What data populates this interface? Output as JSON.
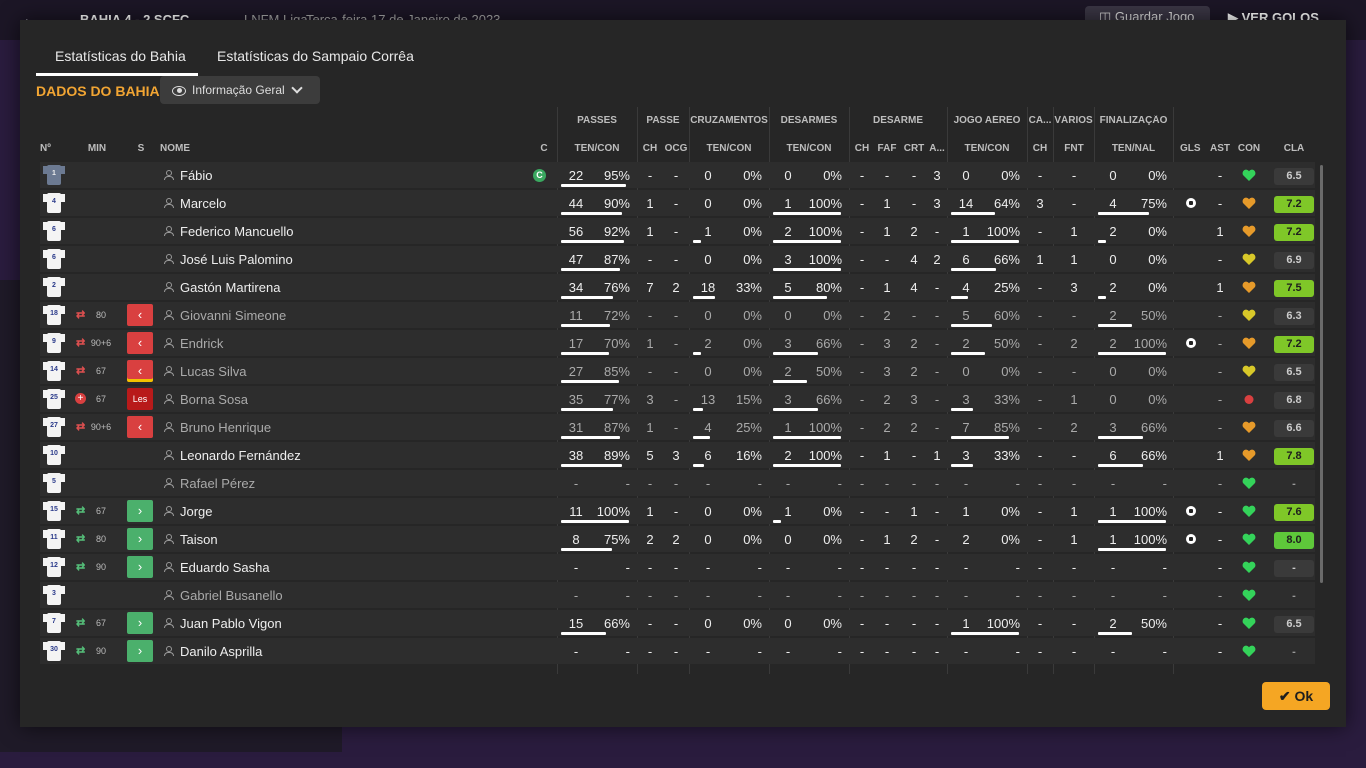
{
  "background": {
    "back_icon": "arrow-left-icon",
    "scoreline": "BAHIA 4 - 2 SCFC",
    "competition": "LNFM Liga",
    "date": "Terça-feira 17 de Janeiro de 2023",
    "save_button": "Guardar Jogo",
    "goals_button": "VER GOLOS"
  },
  "tabs": [
    {
      "label": "Estatísticas do Bahia",
      "active": true
    },
    {
      "label": "Estatísticas do Sampaio Corrêa",
      "active": false
    }
  ],
  "section_title": "DADOS DO BAHIA",
  "view_dropdown": {
    "label": "Informação Geral",
    "icon": "eye-icon"
  },
  "group_headers": [
    "PASSES",
    "PASSE",
    "CRUZAMENTOS",
    "DESARMES",
    "DESARME",
    "JOGO AÉREO",
    "CA...",
    "VÁRIOS",
    "FINALIZAÇÃO"
  ],
  "column_headers": {
    "num": "Nº",
    "min": "MIN",
    "s": "S",
    "name": "NOME",
    "c": "C",
    "passes": "TEN/CON",
    "passe_ch": "CH",
    "passe_ocg": "OCG",
    "cruz": "TEN/CON",
    "desarmes": "TEN/CON",
    "des_ch": "CH",
    "des_faf": "FAF",
    "des_crt": "CRT",
    "des_a": "A...",
    "aereo": "TEN/CON",
    "ca_ch": "CH",
    "varios_fnt": "FNT",
    "final": "TEN/NAL",
    "gls": "GLS",
    "ast": "AST",
    "con": "CON",
    "cla": "CLA"
  },
  "colors": {
    "accent": "#f2a533",
    "ok_button": "#f5a623",
    "sub_out": "#d94040",
    "sub_in": "#4bb06c",
    "heart_green": "#34d35a",
    "heart_orange": "#e69a2a",
    "heart_yellow": "#d8c829",
    "rating_green": "#7fc728"
  },
  "players": [
    {
      "num": "1",
      "gk": true,
      "min": "",
      "sub": "",
      "name": "Fábio",
      "captain": "C",
      "pass": [
        "22",
        "95%"
      ],
      "pass_frac": 0.95,
      "pch": "-",
      "pocg": "-",
      "cross": [
        "0",
        "0%"
      ],
      "cross_frac": 0,
      "tack": [
        "0",
        "0%"
      ],
      "tack_frac": 0,
      "dch": "-",
      "faf": "-",
      "crt": "-",
      "da": "3",
      "air": [
        "0",
        "0%"
      ],
      "air_frac": 0,
      "cach": "-",
      "fnt": "-",
      "fin": [
        "0",
        "0%"
      ],
      "fin_frac": 0,
      "gls": "",
      "ast": "-",
      "con": "green",
      "cla": "6.5",
      "cla_style": "grey",
      "dim": false
    },
    {
      "num": "4",
      "gk": false,
      "min": "",
      "sub": "",
      "name": "Marcelo",
      "captain": "",
      "pass": [
        "44",
        "90%"
      ],
      "pass_frac": 0.9,
      "pch": "1",
      "pocg": "-",
      "cross": [
        "0",
        "0%"
      ],
      "cross_frac": 0,
      "tack": [
        "1",
        "100%"
      ],
      "tack_frac": 1,
      "dch": "-",
      "faf": "1",
      "crt": "-",
      "da": "3",
      "air": [
        "14",
        "64%"
      ],
      "air_frac": 0.64,
      "cach": "3",
      "fnt": "-",
      "fin": [
        "4",
        "75%"
      ],
      "fin_frac": 0.75,
      "gls": "ball",
      "ast": "-",
      "con": "orange",
      "cla": "7.2",
      "cla_style": "green",
      "dim": false
    },
    {
      "num": "6",
      "gk": false,
      "min": "",
      "sub": "",
      "name": "Federico Mancuello",
      "captain": "",
      "pass": [
        "56",
        "92%"
      ],
      "pass_frac": 0.92,
      "pch": "1",
      "pocg": "-",
      "cross": [
        "1",
        "0%"
      ],
      "cross_frac": 0,
      "tack": [
        "2",
        "100%"
      ],
      "tack_frac": 1,
      "dch": "-",
      "faf": "1",
      "crt": "2",
      "da": "-",
      "air": [
        "1",
        "100%"
      ],
      "air_frac": 1,
      "cach": "-",
      "fnt": "1",
      "fin": [
        "2",
        "0%"
      ],
      "fin_frac": 0,
      "gls": "",
      "ast": "1",
      "con": "orange",
      "cla": "7.2",
      "cla_style": "green",
      "dim": false
    },
    {
      "num": "6",
      "gk": false,
      "min": "",
      "sub": "",
      "name": "José Luis Palomino",
      "captain": "",
      "pass": [
        "47",
        "87%"
      ],
      "pass_frac": 0.87,
      "pch": "-",
      "pocg": "-",
      "cross": [
        "0",
        "0%"
      ],
      "cross_frac": 0,
      "tack": [
        "3",
        "100%"
      ],
      "tack_frac": 1,
      "dch": "-",
      "faf": "-",
      "crt": "4",
      "da": "2",
      "air": [
        "6",
        "66%"
      ],
      "air_frac": 0.66,
      "cach": "1",
      "fnt": "1",
      "fin": [
        "0",
        "0%"
      ],
      "fin_frac": 0,
      "gls": "",
      "ast": "-",
      "con": "yellow",
      "cla": "6.9",
      "cla_style": "grey",
      "dim": false
    },
    {
      "num": "2",
      "gk": false,
      "min": "",
      "sub": "",
      "name": "Gastón Martirena",
      "captain": "",
      "pass": [
        "34",
        "76%"
      ],
      "pass_frac": 0.76,
      "pch": "7",
      "pocg": "2",
      "cross": [
        "18",
        "33%"
      ],
      "cross_frac": 0.33,
      "tack": [
        "5",
        "80%"
      ],
      "tack_frac": 0.8,
      "dch": "-",
      "faf": "1",
      "crt": "4",
      "da": "-",
      "air": [
        "4",
        "25%"
      ],
      "air_frac": 0.25,
      "cach": "-",
      "fnt": "3",
      "fin": [
        "2",
        "0%"
      ],
      "fin_frac": 0,
      "gls": "",
      "ast": "1",
      "con": "orange",
      "cla": "7.5",
      "cla_style": "green",
      "dim": false
    },
    {
      "num": "18",
      "gk": false,
      "min": "80",
      "sub": "out",
      "name": "Giovanni Simeone",
      "captain": "",
      "pass": [
        "11",
        "72%"
      ],
      "pass_frac": 0.72,
      "pch": "-",
      "pocg": "-",
      "cross": [
        "0",
        "0%"
      ],
      "cross_frac": 0,
      "tack": [
        "0",
        "0%"
      ],
      "tack_frac": 0,
      "dch": "-",
      "faf": "2",
      "crt": "-",
      "da": "-",
      "air": [
        "5",
        "60%"
      ],
      "air_frac": 0.6,
      "cach": "-",
      "fnt": "-",
      "fin": [
        "2",
        "50%"
      ],
      "fin_frac": 0.5,
      "gls": "",
      "ast": "-",
      "con": "yellow",
      "cla": "6.3",
      "cla_style": "grey",
      "dim": true
    },
    {
      "num": "9",
      "gk": false,
      "min": "90+6",
      "sub": "out",
      "name": "Endrick",
      "captain": "",
      "pass": [
        "17",
        "70%"
      ],
      "pass_frac": 0.7,
      "pch": "1",
      "pocg": "-",
      "cross": [
        "2",
        "0%"
      ],
      "cross_frac": 0,
      "tack": [
        "3",
        "66%"
      ],
      "tack_frac": 0.66,
      "dch": "-",
      "faf": "3",
      "crt": "2",
      "da": "-",
      "air": [
        "2",
        "50%"
      ],
      "air_frac": 0.5,
      "cach": "-",
      "fnt": "2",
      "fin": [
        "2",
        "100%"
      ],
      "fin_frac": 1,
      "gls": "ball",
      "ast": "-",
      "con": "orange",
      "cla": "7.2",
      "cla_style": "green",
      "dim": true
    },
    {
      "num": "14",
      "gk": false,
      "min": "67",
      "sub": "out-yc",
      "name": "Lucas Silva",
      "captain": "",
      "pass": [
        "27",
        "85%"
      ],
      "pass_frac": 0.85,
      "pch": "-",
      "pocg": "-",
      "cross": [
        "0",
        "0%"
      ],
      "cross_frac": 0,
      "tack": [
        "2",
        "50%"
      ],
      "tack_frac": 0.5,
      "dch": "-",
      "faf": "3",
      "crt": "2",
      "da": "-",
      "air": [
        "0",
        "0%"
      ],
      "air_frac": 0,
      "cach": "-",
      "fnt": "-",
      "fin": [
        "0",
        "0%"
      ],
      "fin_frac": 0,
      "gls": "",
      "ast": "-",
      "con": "yellow",
      "cla": "6.5",
      "cla_style": "grey",
      "dim": true
    },
    {
      "num": "25",
      "gk": false,
      "min": "67",
      "sub": "inj",
      "sub_label": "Les",
      "name": "Borna Sosa",
      "captain": "",
      "pass": [
        "35",
        "77%"
      ],
      "pass_frac": 0.77,
      "pch": "3",
      "pocg": "-",
      "cross": [
        "13",
        "15%"
      ],
      "cross_frac": 0.15,
      "tack": [
        "3",
        "66%"
      ],
      "tack_frac": 0.66,
      "dch": "-",
      "faf": "2",
      "crt": "3",
      "da": "-",
      "air": [
        "3",
        "33%"
      ],
      "air_frac": 0.33,
      "cach": "-",
      "fnt": "1",
      "fin": [
        "0",
        "0%"
      ],
      "fin_frac": 0,
      "gls": "",
      "ast": "-",
      "con": "red",
      "cla": "6.8",
      "cla_style": "grey",
      "dim": true
    },
    {
      "num": "27",
      "gk": false,
      "min": "90+6",
      "sub": "out",
      "name": "Bruno Henrique",
      "captain": "",
      "pass": [
        "31",
        "87%"
      ],
      "pass_frac": 0.87,
      "pch": "1",
      "pocg": "-",
      "cross": [
        "4",
        "25%"
      ],
      "cross_frac": 0.25,
      "tack": [
        "1",
        "100%"
      ],
      "tack_frac": 1,
      "dch": "-",
      "faf": "2",
      "crt": "2",
      "da": "-",
      "air": [
        "7",
        "85%"
      ],
      "air_frac": 0.85,
      "cach": "-",
      "fnt": "2",
      "fin": [
        "3",
        "66%"
      ],
      "fin_frac": 0.66,
      "gls": "",
      "ast": "-",
      "con": "orange",
      "cla": "6.6",
      "cla_style": "grey",
      "dim": true
    },
    {
      "num": "10",
      "gk": false,
      "min": "",
      "sub": "",
      "name": "Leonardo Fernández",
      "captain": "",
      "pass": [
        "38",
        "89%"
      ],
      "pass_frac": 0.89,
      "pch": "5",
      "pocg": "3",
      "cross": [
        "6",
        "16%"
      ],
      "cross_frac": 0.16,
      "tack": [
        "2",
        "100%"
      ],
      "tack_frac": 1,
      "dch": "-",
      "faf": "1",
      "crt": "-",
      "da": "1",
      "air": [
        "3",
        "33%"
      ],
      "air_frac": 0.33,
      "cach": "-",
      "fnt": "-",
      "fin": [
        "6",
        "66%"
      ],
      "fin_frac": 0.66,
      "gls": "",
      "ast": "1",
      "con": "orange",
      "cla": "7.8",
      "cla_style": "green",
      "dim": false
    },
    {
      "num": "5",
      "gk": false,
      "min": "",
      "sub": "",
      "name": "Rafael Pérez",
      "captain": "",
      "pass": [
        "-",
        "-"
      ],
      "pass_frac": 0,
      "pch": "-",
      "pocg": "-",
      "cross": [
        "-",
        "-"
      ],
      "cross_frac": 0,
      "tack": [
        "-",
        "-"
      ],
      "tack_frac": 0,
      "dch": "-",
      "faf": "-",
      "crt": "-",
      "da": "-",
      "air": [
        "-",
        "-"
      ],
      "air_frac": 0,
      "cach": "-",
      "fnt": "-",
      "fin": [
        "-",
        "-"
      ],
      "fin_frac": 0,
      "gls": "",
      "ast": "-",
      "con": "green",
      "cla": "-",
      "cla_style": "none",
      "dim": true
    },
    {
      "num": "15",
      "gk": false,
      "min": "67",
      "sub": "in",
      "name": "Jorge",
      "captain": "",
      "pass": [
        "11",
        "100%"
      ],
      "pass_frac": 1,
      "pch": "1",
      "pocg": "-",
      "cross": [
        "0",
        "0%"
      ],
      "cross_frac": 0,
      "tack": [
        "1",
        "0%"
      ],
      "tack_frac": 0,
      "dch": "-",
      "faf": "-",
      "crt": "1",
      "da": "-",
      "air": [
        "1",
        "0%"
      ],
      "air_frac": 0,
      "cach": "-",
      "fnt": "1",
      "fin": [
        "1",
        "100%"
      ],
      "fin_frac": 1,
      "gls": "ball",
      "ast": "-",
      "con": "green",
      "cla": "7.6",
      "cla_style": "green",
      "dim": false
    },
    {
      "num": "11",
      "gk": false,
      "min": "80",
      "sub": "in",
      "name": "Taison",
      "captain": "",
      "pass": [
        "8",
        "75%"
      ],
      "pass_frac": 0.75,
      "pch": "2",
      "pocg": "2",
      "cross": [
        "0",
        "0%"
      ],
      "cross_frac": 0,
      "tack": [
        "0",
        "0%"
      ],
      "tack_frac": 0,
      "dch": "-",
      "faf": "1",
      "crt": "2",
      "da": "-",
      "air": [
        "2",
        "0%"
      ],
      "air_frac": 0,
      "cach": "-",
      "fnt": "1",
      "fin": [
        "1",
        "100%"
      ],
      "fin_frac": 1,
      "gls": "ball",
      "ast": "-",
      "con": "green",
      "cla": "8.0",
      "cla_style": "lgreen",
      "dim": false
    },
    {
      "num": "12",
      "gk": false,
      "min": "90",
      "sub": "in",
      "name": "Eduardo Sasha",
      "captain": "",
      "pass": [
        "-",
        "-"
      ],
      "pass_frac": 0,
      "pch": "-",
      "pocg": "-",
      "cross": [
        "-",
        "-"
      ],
      "cross_frac": 0,
      "tack": [
        "-",
        "-"
      ],
      "tack_frac": 0,
      "dch": "-",
      "faf": "-",
      "crt": "-",
      "da": "-",
      "air": [
        "-",
        "-"
      ],
      "air_frac": 0,
      "cach": "-",
      "fnt": "-",
      "fin": [
        "-",
        "-"
      ],
      "fin_frac": 0,
      "gls": "",
      "ast": "-",
      "con": "green",
      "cla": "-",
      "cla_style": "grey",
      "dim": false
    },
    {
      "num": "3",
      "gk": false,
      "min": "",
      "sub": "",
      "name": "Gabriel Busanello",
      "captain": "",
      "pass": [
        "-",
        "-"
      ],
      "pass_frac": 0,
      "pch": "-",
      "pocg": "-",
      "cross": [
        "-",
        "-"
      ],
      "cross_frac": 0,
      "tack": [
        "-",
        "-"
      ],
      "tack_frac": 0,
      "dch": "-",
      "faf": "-",
      "crt": "-",
      "da": "-",
      "air": [
        "-",
        "-"
      ],
      "air_frac": 0,
      "cach": "-",
      "fnt": "-",
      "fin": [
        "-",
        "-"
      ],
      "fin_frac": 0,
      "gls": "",
      "ast": "-",
      "con": "green",
      "cla": "-",
      "cla_style": "none",
      "dim": true
    },
    {
      "num": "7",
      "gk": false,
      "min": "67",
      "sub": "in",
      "name": "Juan Pablo Vigon",
      "captain": "",
      "pass": [
        "15",
        "66%"
      ],
      "pass_frac": 0.66,
      "pch": "-",
      "pocg": "-",
      "cross": [
        "0",
        "0%"
      ],
      "cross_frac": 0,
      "tack": [
        "0",
        "0%"
      ],
      "tack_frac": 0,
      "dch": "-",
      "faf": "-",
      "crt": "-",
      "da": "-",
      "air": [
        "1",
        "100%"
      ],
      "air_frac": 1,
      "cach": "-",
      "fnt": "-",
      "fin": [
        "2",
        "50%"
      ],
      "fin_frac": 0.5,
      "gls": "",
      "ast": "-",
      "con": "green",
      "cla": "6.5",
      "cla_style": "grey",
      "dim": false
    },
    {
      "num": "30",
      "gk": false,
      "min": "90",
      "sub": "in",
      "name": "Danilo Asprilla",
      "captain": "",
      "pass": [
        "-",
        "-"
      ],
      "pass_frac": 0,
      "pch": "-",
      "pocg": "-",
      "cross": [
        "-",
        "-"
      ],
      "cross_frac": 0,
      "tack": [
        "-",
        "-"
      ],
      "tack_frac": 0,
      "dch": "-",
      "faf": "-",
      "crt": "-",
      "da": "-",
      "air": [
        "-",
        "-"
      ],
      "air_frac": 0,
      "cach": "-",
      "fnt": "-",
      "fin": [
        "-",
        "-"
      ],
      "fin_frac": 0,
      "gls": "",
      "ast": "-",
      "con": "green",
      "cla": "-",
      "cla_style": "none",
      "dim": false
    }
  ],
  "ok_button": "Ok"
}
